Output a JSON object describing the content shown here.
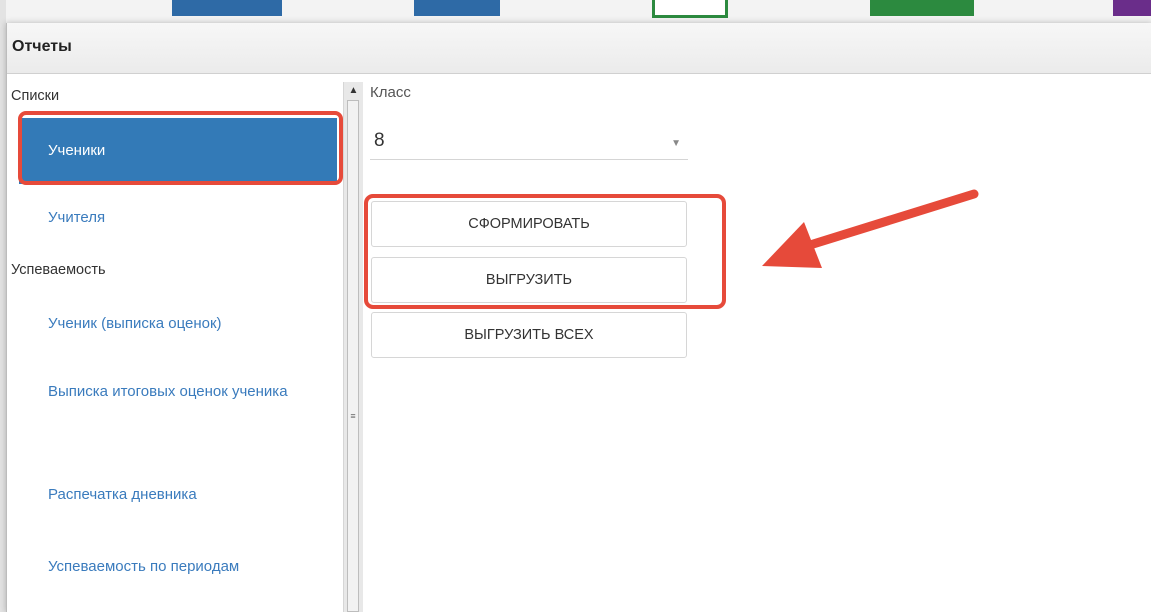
{
  "dialog": {
    "title": "Отчеты"
  },
  "sidebar": {
    "groups": [
      {
        "label": "Списки",
        "items": [
          "Ученики",
          "Учителя"
        ]
      },
      {
        "label": "Успеваемость",
        "items": [
          "Ученик (выписка оценок)",
          "Выписка итоговых оценок ученика",
          "Распечатка дневника",
          "Успеваемость по периодам"
        ]
      }
    ],
    "active_item": "Ученики"
  },
  "form": {
    "class_label": "Класс",
    "class_value": "8",
    "buttons": [
      "СФОРМИРОВАТЬ",
      "ВЫГРУЗИТЬ",
      "ВЫГРУЗИТЬ ВСЕХ"
    ]
  },
  "annotations": {
    "highlight_color": "#e64a3a"
  },
  "colors": {
    "accent": "#337ab7",
    "link": "#3a7bbd"
  }
}
